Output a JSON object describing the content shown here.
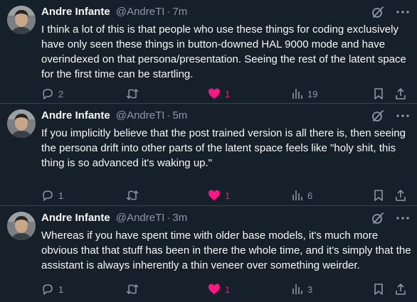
{
  "colors": {
    "background": "#15202b",
    "text": "#f7f9f9",
    "muted": "#8b98a5",
    "divider": "#38444d",
    "like": "#f91880"
  },
  "tweets": [
    {
      "name": "Andre Infante",
      "handle": "@AndreTI",
      "separator": "·",
      "time": "7m",
      "text": "I think a lot of this is that people who use these things for coding exclusively have only seen these things in button-downed HAL 9000 mode and have overindexed on that persona/presentation. Seeing the rest of the latent space for the first time can be startling.",
      "replies": "2",
      "retweets": "",
      "likes": "1",
      "liked": true,
      "views": "19"
    },
    {
      "name": "Andre Infante",
      "handle": "@AndreTI",
      "separator": "·",
      "time": "5m",
      "text": "If you implicitly believe that the post trained version is all there is, then seeing the persona drift into other parts of the latent space feels like \"holy shit, this thing is so advanced it's waking up.\"",
      "replies": "1",
      "retweets": "",
      "likes": "1",
      "liked": true,
      "views": "6"
    },
    {
      "name": "Andre Infante",
      "handle": "@AndreTI",
      "separator": "·",
      "time": "3m",
      "text": "Whereas if you have spent time with older base models, it's much more obvious that that stuff has been in there the whole time, and it's simply that the assistant is always inherently a thin veneer over something weirder.",
      "replies": "1",
      "retweets": "",
      "likes": "1",
      "liked": true,
      "views": "3"
    }
  ],
  "icons": {
    "avatar": "avatar",
    "grok": "grok-icon",
    "more": "more-icon",
    "reply": "reply-icon",
    "retweet": "retweet-icon",
    "like": "heart-icon",
    "views": "views-icon",
    "bookmark": "bookmark-icon",
    "share": "share-icon"
  }
}
